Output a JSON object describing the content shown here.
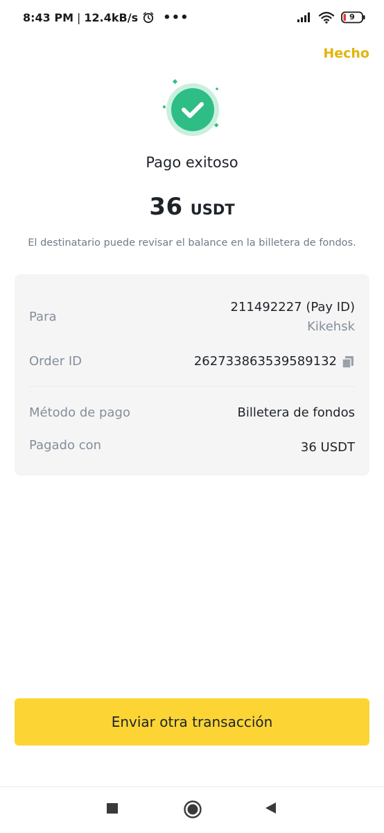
{
  "status_bar": {
    "time": "8:43 PM",
    "separator": "|",
    "speed": "12.4kB/s",
    "more": "•••",
    "battery": "9"
  },
  "header": {
    "done_label": "Hecho"
  },
  "result": {
    "title": "Pago exitoso",
    "amount": "36",
    "currency": "USDT",
    "note": "El destinatario puede revisar el balance en la billetera de fondos."
  },
  "details": {
    "to_label": "Para",
    "to_value": "211492227 (Pay ID)",
    "to_name": "Kikehsk",
    "order_label": "Order ID",
    "order_value": "262733863539589132",
    "method_label": "Método de pago",
    "method_value": "Billetera de fondos",
    "paid_label": "Pagado con",
    "paid_value": "36 USDT"
  },
  "actions": {
    "send_another": "Enviar otra transacción"
  },
  "colors": {
    "accent": "#fcd535",
    "done_text": "#e3b40b",
    "success": "#2ebd85"
  },
  "icons": {
    "success": "check-circle-icon",
    "copy": "copy-icon",
    "alarm": "alarm-icon",
    "signal": "signal-icon",
    "wifi": "wifi-icon",
    "battery": "battery-icon",
    "nav_recent": "square-icon",
    "nav_home": "circle-icon",
    "nav_back": "back-triangle-icon"
  }
}
